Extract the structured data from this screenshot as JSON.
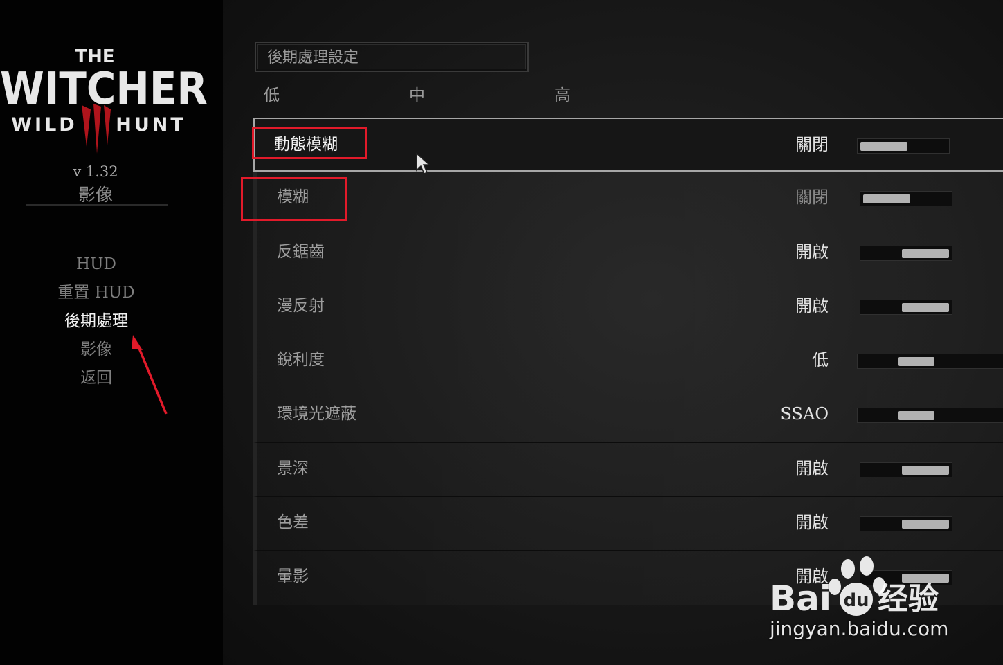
{
  "sidebar": {
    "logo": {
      "line1": "THE",
      "line2": "WITCHER",
      "line3_left": "WILD",
      "line3_right": "HUNT",
      "numeral": "III"
    },
    "version": "v 1.32",
    "section": "影像",
    "menu": [
      {
        "label": "HUD"
      },
      {
        "label": "重置 HUD"
      },
      {
        "label": "後期處理"
      },
      {
        "label": "影像"
      },
      {
        "label": "返回"
      }
    ],
    "active_index": 2
  },
  "main": {
    "title": "後期處理設定",
    "presets": [
      "低",
      "中",
      "高"
    ],
    "settings": [
      {
        "label": "動態模糊",
        "value": "關閉",
        "level": 0,
        "selected": true
      },
      {
        "label": "模糊",
        "value": "關閉",
        "level": 0
      },
      {
        "label": "反鋸齒",
        "value": "開啟",
        "level": 1
      },
      {
        "label": "漫反射",
        "value": "開啟",
        "level": 1
      },
      {
        "label": "銳利度",
        "value": "低",
        "level": 0.55
      },
      {
        "label": "環境光遮蔽",
        "value": "SSAO",
        "level": 0.55
      },
      {
        "label": "景深",
        "value": "開啟",
        "level": 1
      },
      {
        "label": "色差",
        "value": "開啟",
        "level": 1
      },
      {
        "label": "暈影",
        "value": "開啟",
        "level": 1
      }
    ]
  },
  "watermark": {
    "brand": "Bai",
    "brand2": "经验",
    "url": "jingyan.baidu.com"
  },
  "colors": {
    "accent_red": "#e21a2a",
    "logo_red": "#b0141c"
  }
}
